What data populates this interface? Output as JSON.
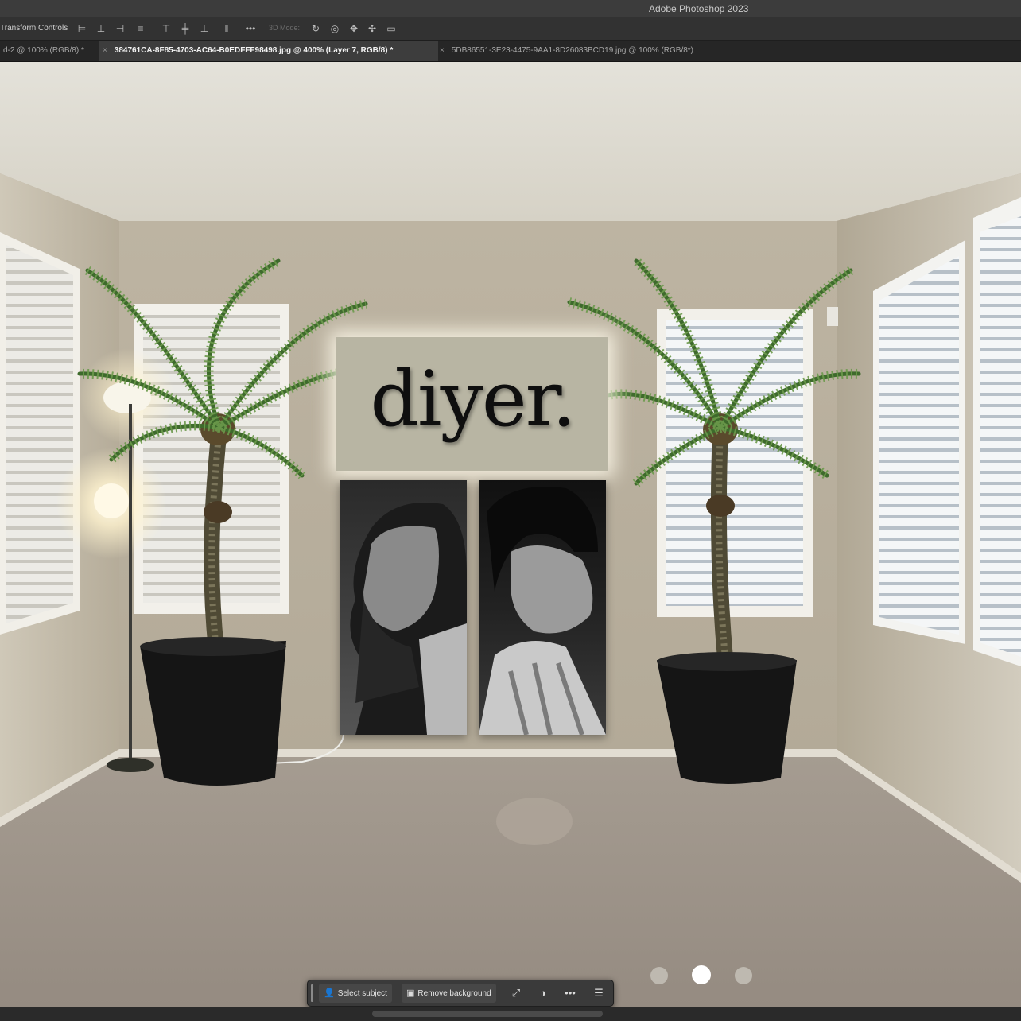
{
  "app": {
    "title": "Adobe Photoshop 2023"
  },
  "options_bar": {
    "transform_controls": "Transform Controls",
    "mode_3d": "3D Mode:",
    "icons": [
      "align-left-icon",
      "align-center-h-icon",
      "align-right-icon",
      "distribute-h-icon",
      "align-top-icon",
      "align-middle-v-icon",
      "align-bottom-icon",
      "distribute-v-icon",
      "more-icon",
      "orbit-3d-icon",
      "roll-3d-icon",
      "pan-3d-icon",
      "slide-3d-icon",
      "scale-3d-icon"
    ]
  },
  "tabs": [
    {
      "label": "d-2 @ 100% (RGB/8) *",
      "active": false
    },
    {
      "label": "384761CA-8F85-4703-AC64-B0EDFFF98498.jpg @ 400% (Layer 7, RGB/8) *",
      "active": true
    },
    {
      "label": "5DB86551-3E23-4475-9AA1-8D26083BCD19.jpg @ 100% (RGB/8*)",
      "active": false
    }
  ],
  "canvas": {
    "sign_text": "diyer.",
    "wall_color": "#b7ae9d",
    "floor_color": "#a0968c"
  },
  "task_bar": {
    "select_subject": "Select subject",
    "remove_background": "Remove background",
    "icons": [
      "transform-icon",
      "adjustment-icon",
      "more-options-icon",
      "settings-icon"
    ]
  },
  "pager": {
    "count": 3,
    "active_index": 1
  }
}
